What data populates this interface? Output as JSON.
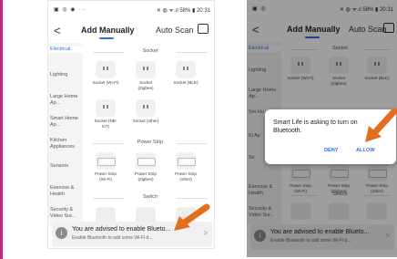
{
  "accent": "#2c6ee8",
  "arrow_color": "#e36e1f",
  "left_screen": {
    "status_bar": {
      "left_icons": "▣ ◎ ◉ ···",
      "right_text": "✕ ◍ ᯤ.ıl 58% ▮ 20:31"
    },
    "header": {
      "back": "<",
      "tab_active": "Add Manually",
      "tab_other": "Auto Scan",
      "scan_icon": "scan-icon"
    },
    "sidebar": [
      "Electrical",
      "Lighting",
      "Large Home Ap...",
      "Smart Home Ap...",
      "Kitchen Appliances",
      "Sensors",
      "Exercise & Health",
      "Security & Video Sur..."
    ],
    "sections": {
      "socket": "Socket",
      "power_strip": "Power Strip",
      "switch": "Switch"
    },
    "socket_devices": [
      "Socket (Wi-Fi)",
      "Socket (Zigbee)",
      "Socket (BLE)",
      "Socket (NB-IoT)",
      "Socket (other)"
    ],
    "strip_devices": [
      "Power Strip (Wi-Fi)",
      "Power Strip (Zigbee)",
      "Power Strip (other)"
    ],
    "banner": {
      "title": "You are advised to enable Blueto...",
      "subtitle": "Enable Bluetooth to add some Wi-Fi d...",
      "chevron": ">"
    }
  },
  "right_screen": {
    "status_bar": {
      "left_icons": "▣ ◎",
      "right_text": "✕ ◍ ᯤ.ıl 58% ▮ 20:31"
    },
    "header": {
      "back": "<",
      "tab_active": "Add Manually",
      "tab_other": "Auto Scan",
      "scan_icon": "scan-icon"
    },
    "sidebar": [
      "Electrical",
      "Lighting",
      "Large Home Ap...",
      "Sm Ho",
      "Ki Ap",
      "Se",
      "Exercise & Health",
      "Security & Video Sur..."
    ],
    "sections": {
      "socket": "Socket",
      "switch": "Switch"
    },
    "socket_devices": [
      "Socket (Wi-Fi)",
      "Socket (Zigbee)",
      "Socket (BLE)"
    ],
    "strip_devices": [
      "Power Strip (Wi-Fi)",
      "Power Strip (Zigbee)",
      "Power Strip (other)"
    ],
    "dialog": {
      "message": "Smart Life is asking to turn on Bluetooth.",
      "deny": "DENY",
      "allow": "ALLOW"
    },
    "banner": {
      "title": "You are advised to enable Blueto...",
      "subtitle": "Enable Bluetooth to add some Wi-Fi d...",
      "chevron": ">"
    }
  }
}
